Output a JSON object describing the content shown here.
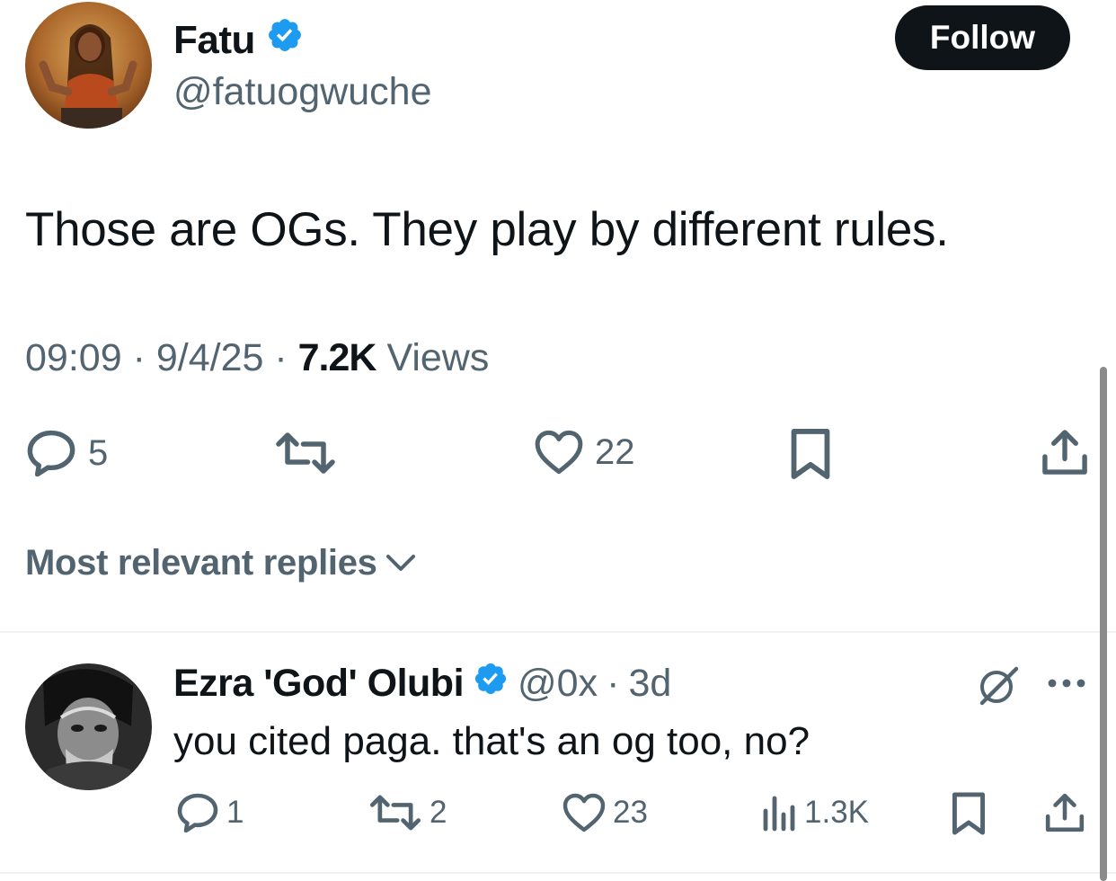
{
  "tweet": {
    "author": {
      "name": "Fatu",
      "handle": "@fatuogwuche",
      "verified": true,
      "avatar_icon": "profile-photo"
    },
    "follow_label": "Follow",
    "text": "Those are OGs. They play by different rules.",
    "time": "09:09",
    "date": "9/4/25",
    "separator": "·",
    "views_count": "7.2K",
    "views_label": "Views",
    "actions": {
      "reply_count": "5",
      "retweet_count": "",
      "like_count": "22"
    }
  },
  "replies_sort_label": "Most relevant replies",
  "reply": {
    "name": "Ezra 'God' Olubi",
    "handle": "@0x",
    "separator": "·",
    "age": "3d",
    "verified": true,
    "text": "you cited paga. that's an og too, no?",
    "actions": {
      "reply_count": "1",
      "retweet_count": "2",
      "like_count": "23",
      "views_count": "1.3K"
    }
  },
  "colors": {
    "text": "#0f1419",
    "secondary": "#536471",
    "verified": "#1d9bf0",
    "button_bg": "#0f1419",
    "divider": "#eff3f4"
  }
}
